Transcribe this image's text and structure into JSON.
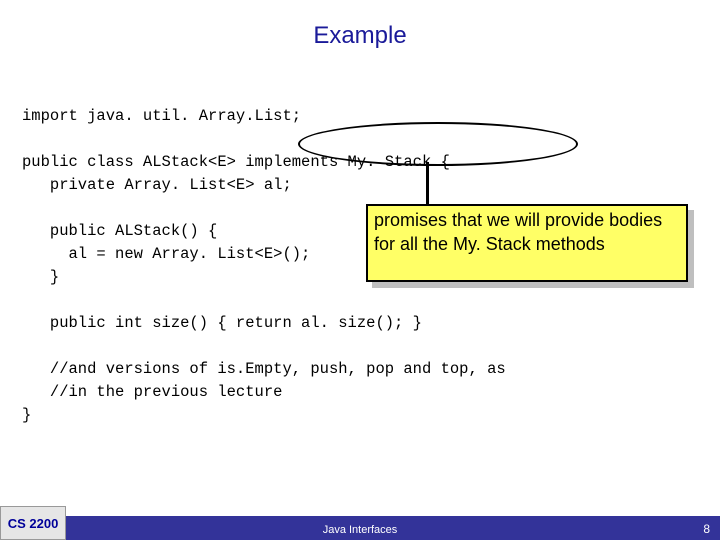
{
  "title": "Example",
  "code": {
    "l1": "import java. util. Array.List;",
    "l2": "public class ALStack<E> implements My. Stack {",
    "l3": "   private Array. List<E> al;",
    "l4": "   public ALStack() {",
    "l5": "     al = new Array. List<E>();",
    "l6": "   }",
    "l7": "   public int size() { return al. size(); }",
    "l8": "   //and versions of is.Empty, push, pop and top, as",
    "l9": "   //in the previous lecture",
    "l10": "}"
  },
  "callout": "promises that we will provide bodies for all the My. Stack methods",
  "footer": {
    "course": "CS 2200",
    "center": "Java Interfaces",
    "page": "8"
  }
}
